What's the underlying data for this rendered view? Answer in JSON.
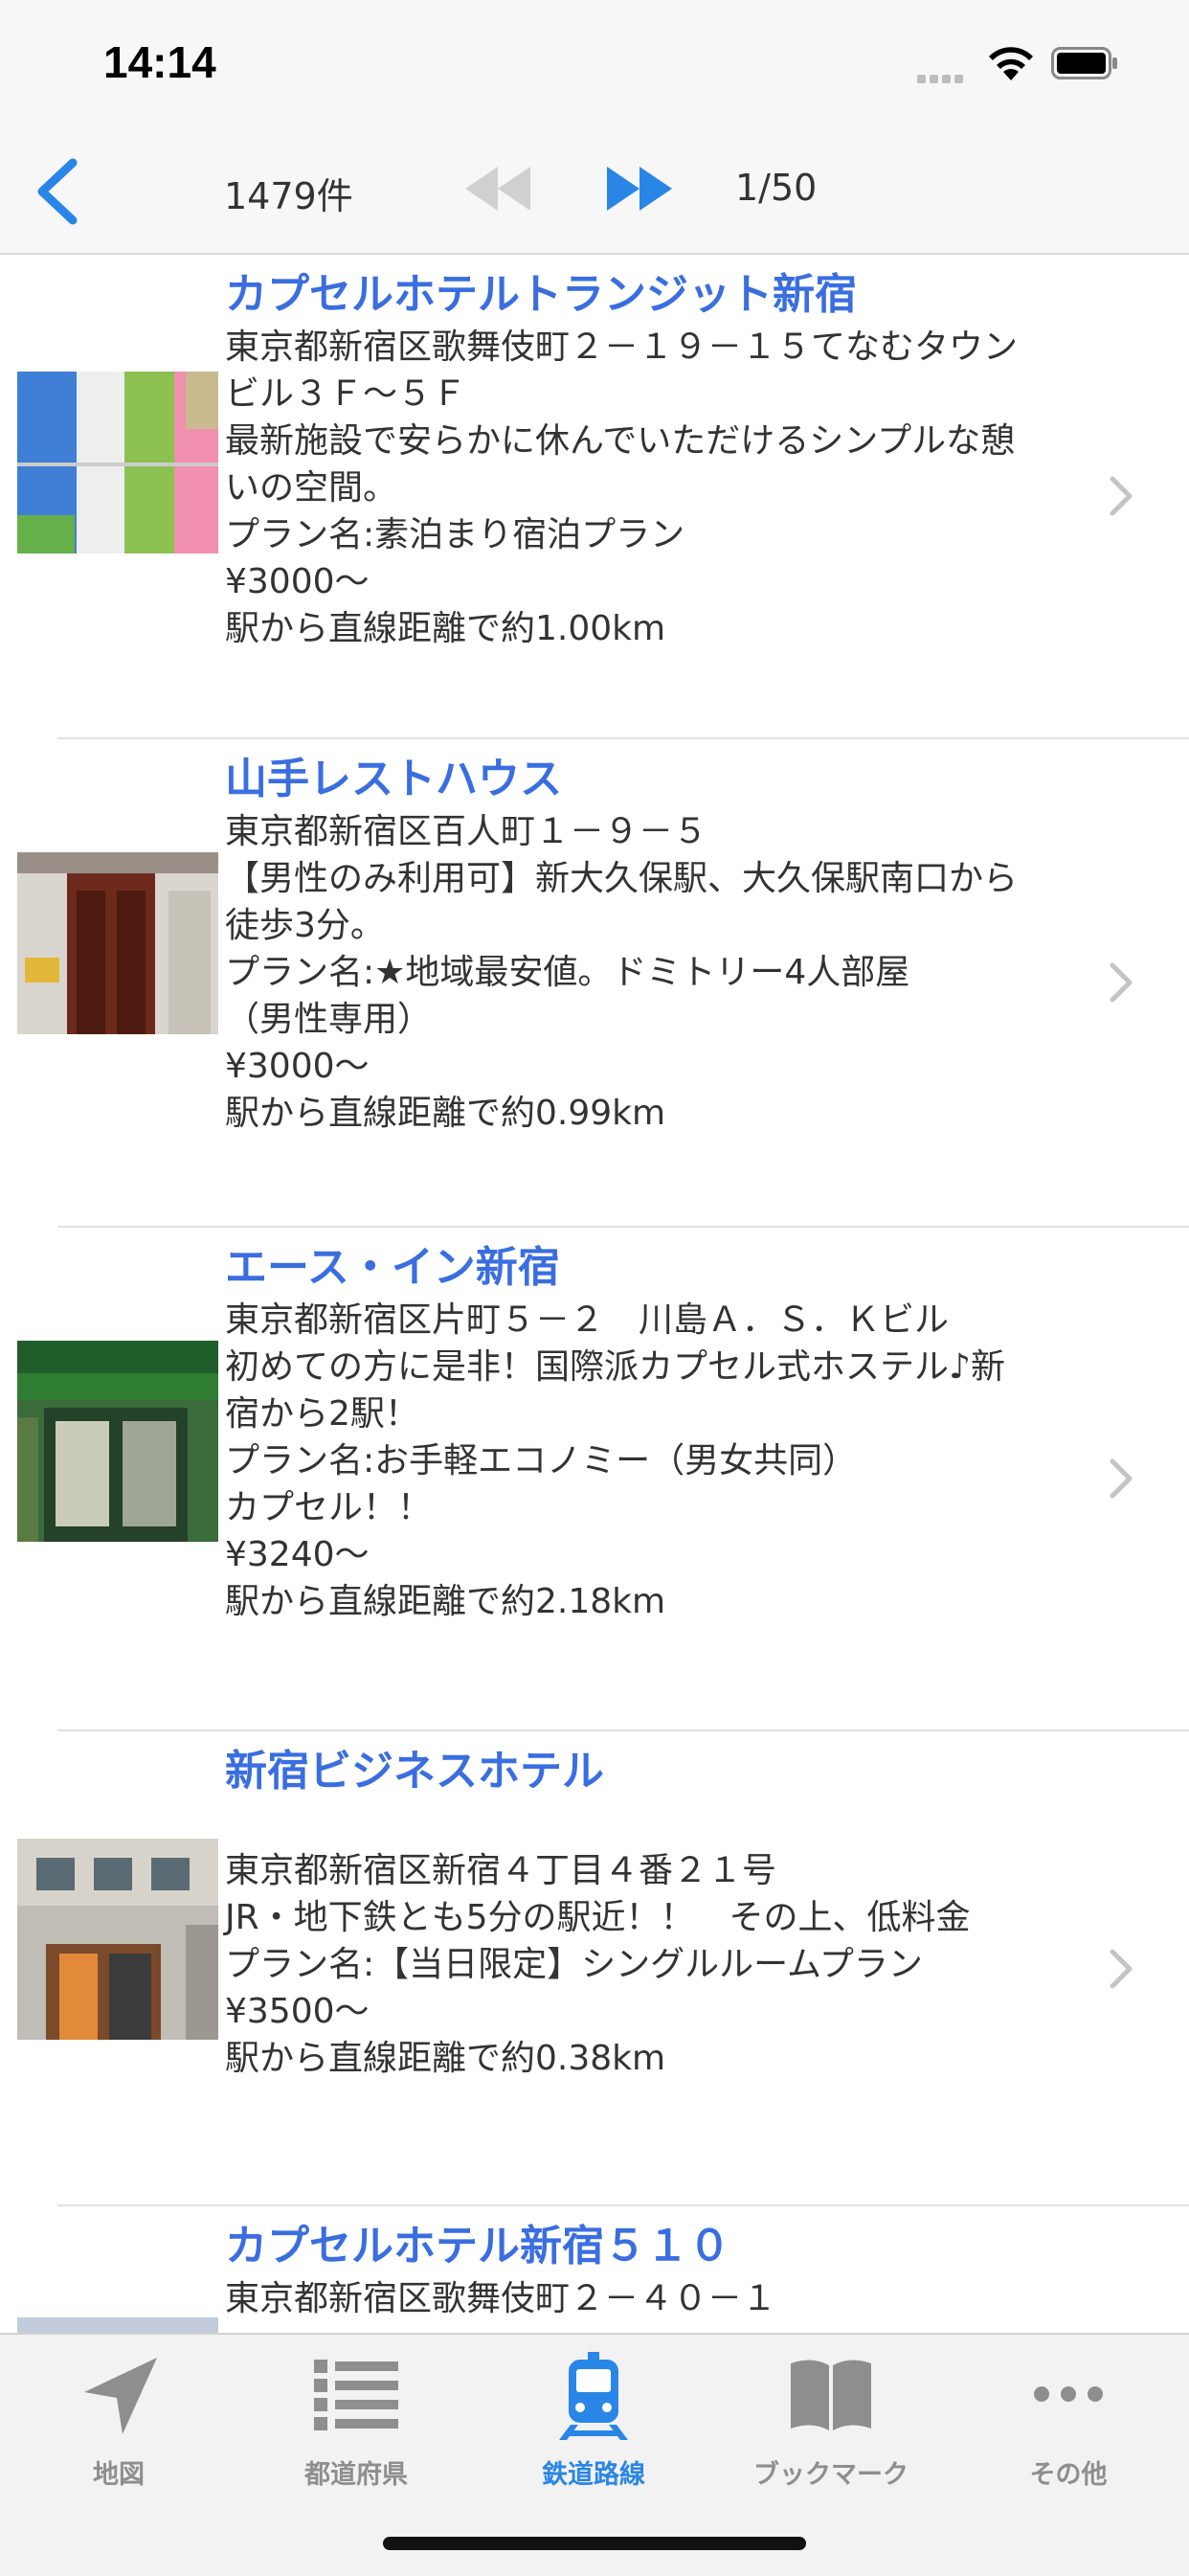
{
  "status_bar": {
    "time": "14:14"
  },
  "nav": {
    "count": "1479件",
    "page": "1/50"
  },
  "hotels": [
    {
      "name": "カプセルホテルトランジット新宿",
      "lines": [
        "東京都新宿区歌舞伎町２－１９－１５てなむタウン",
        "ビル３Ｆ～５Ｆ",
        "最新施設で安らかに休んでいただけるシンプルな憩",
        "いの空間。",
        "プラン名:素泊まり宿泊プラン",
        "¥3000～",
        "駅から直線距離で約1.00km"
      ]
    },
    {
      "name": "山手レストハウス",
      "lines": [
        "東京都新宿区百人町１－９－５",
        "【男性のみ利用可】新大久保駅、大久保駅南口から",
        "徒歩3分。",
        "プラン名:★地域最安値。ドミトリー4人部屋",
        "（男性専用）",
        "¥3000～",
        "駅から直線距離で約0.99km"
      ]
    },
    {
      "name": "エース・イン新宿",
      "lines": [
        "東京都新宿区片町５－２　川島Ａ．Ｓ．Ｋビル",
        "初めての方に是非！国際派カプセル式ホステル♪新",
        "宿から2駅！",
        "プラン名:お手軽エコノミー（男女共同）",
        "カプセル！！",
        "¥3240～",
        "駅から直線距離で約2.18km"
      ]
    },
    {
      "name": "新宿ビジネスホテル",
      "lines": [
        "",
        "東京都新宿区新宿４丁目４番２１号",
        "JR・地下鉄とも5分の駅近！！　その上、低料金",
        "プラン名:【当日限定】シングルルームプラン",
        "¥3500～",
        "駅から直線距離で約0.38km"
      ]
    },
    {
      "name": "カプセルホテル新宿５１０",
      "lines": [
        "東京都新宿区歌舞伎町２－４０－１"
      ]
    }
  ],
  "tabs": [
    {
      "label": "地図",
      "icon": "location-arrow-icon"
    },
    {
      "label": "都道府県",
      "icon": "list-icon"
    },
    {
      "label": "鉄道路線",
      "icon": "train-icon"
    },
    {
      "label": "ブックマーク",
      "icon": "book-icon"
    },
    {
      "label": "その他",
      "icon": "more-icon"
    }
  ],
  "colors": {
    "accent": "#2a86e6",
    "title": "#3a6ee0",
    "inactive": "#8e8e8e"
  }
}
